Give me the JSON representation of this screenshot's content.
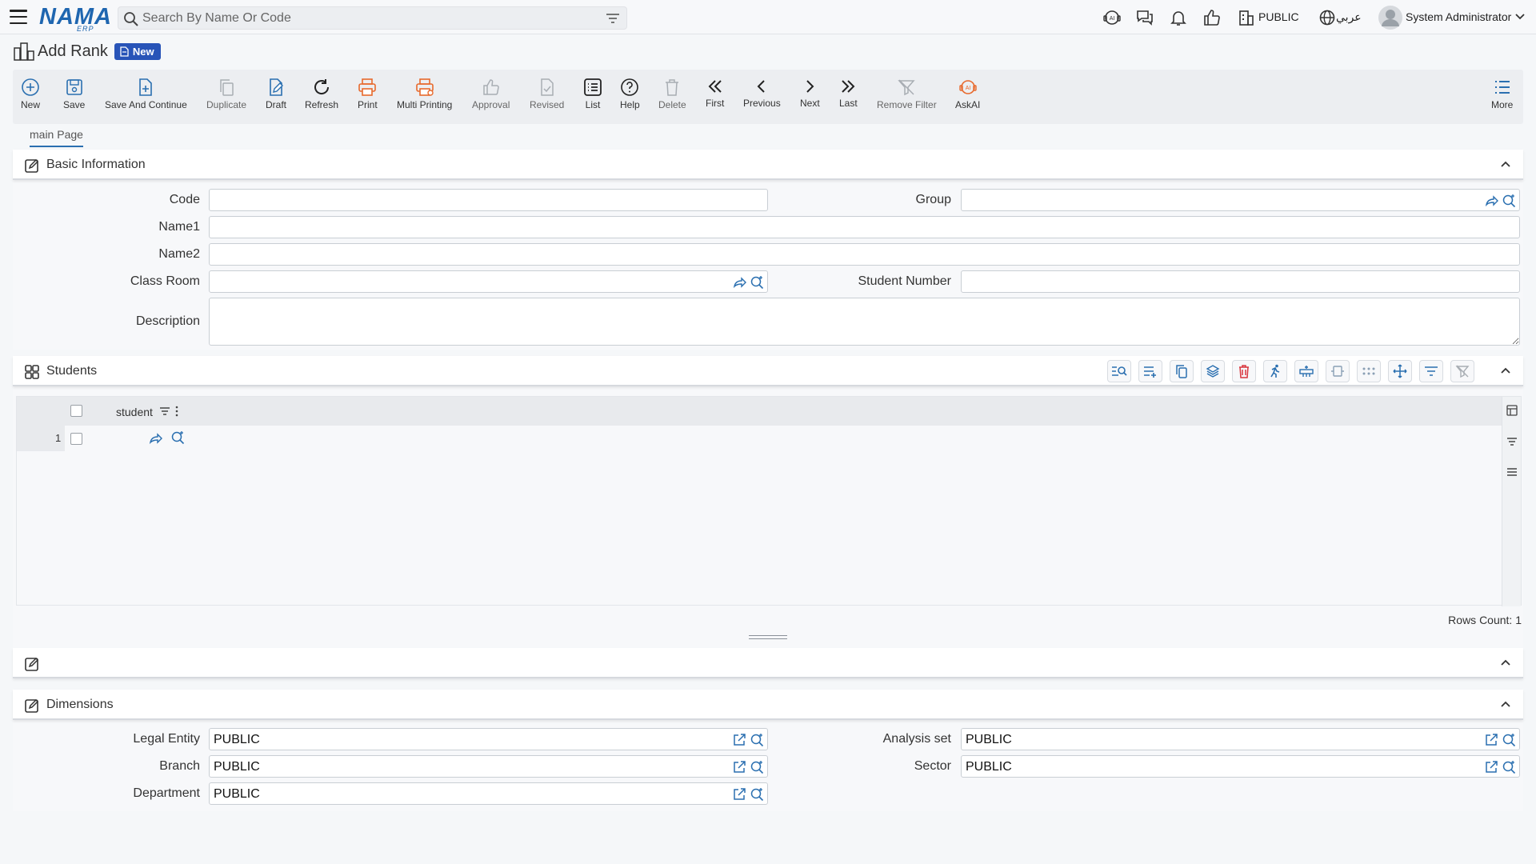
{
  "topbar": {
    "logo": "NAMA",
    "logo_sub": "ERP",
    "search_placeholder": "Search By Name Or Code",
    "company": "PUBLIC",
    "language": "عربي",
    "user": "System Administrator"
  },
  "title": {
    "text": "Add Rank",
    "badge": "New"
  },
  "toolbar": {
    "new": "New",
    "save": "Save",
    "save_continue": "Save And Continue",
    "duplicate": "Duplicate",
    "draft": "Draft",
    "refresh": "Refresh",
    "print": "Print",
    "multi_printing": "Multi Printing",
    "approval": "Approval",
    "revised": "Revised",
    "list": "List",
    "help": "Help",
    "delete": "Delete",
    "first": "First",
    "previous": "Previous",
    "next": "Next",
    "last": "Last",
    "remove_filter": "Remove Filter",
    "askai": "AskAI",
    "more": "More"
  },
  "tabs": {
    "main": "main Page"
  },
  "basic": {
    "title": "Basic Information",
    "code_label": "Code",
    "code_value": "",
    "group_label": "Group",
    "group_value": "",
    "name1_label": "Name1",
    "name1_value": "",
    "name2_label": "Name2",
    "name2_value": "",
    "classroom_label": "Class Room",
    "classroom_value": "",
    "student_number_label": "Student Number",
    "student_number_value": "",
    "description_label": "Description",
    "description_value": ""
  },
  "students": {
    "title": "Students",
    "column": "student",
    "rows": [
      {
        "num": "1",
        "student": ""
      }
    ],
    "rows_count": "Rows Count: 1"
  },
  "dimensions": {
    "title": "Dimensions",
    "legal_entity_label": "Legal Entity",
    "legal_entity_value": "PUBLIC",
    "analysis_set_label": "Analysis set",
    "analysis_set_value": "PUBLIC",
    "branch_label": "Branch",
    "branch_value": "PUBLIC",
    "sector_label": "Sector",
    "sector_value": "PUBLIC",
    "department_label": "Department",
    "department_value": "PUBLIC"
  },
  "colors": {
    "brand": "#1f66b0",
    "badge": "#2854b8",
    "accent_blue": "#2a6fb0",
    "print_orange": "#e8692c",
    "delete_red": "#d9363e"
  }
}
